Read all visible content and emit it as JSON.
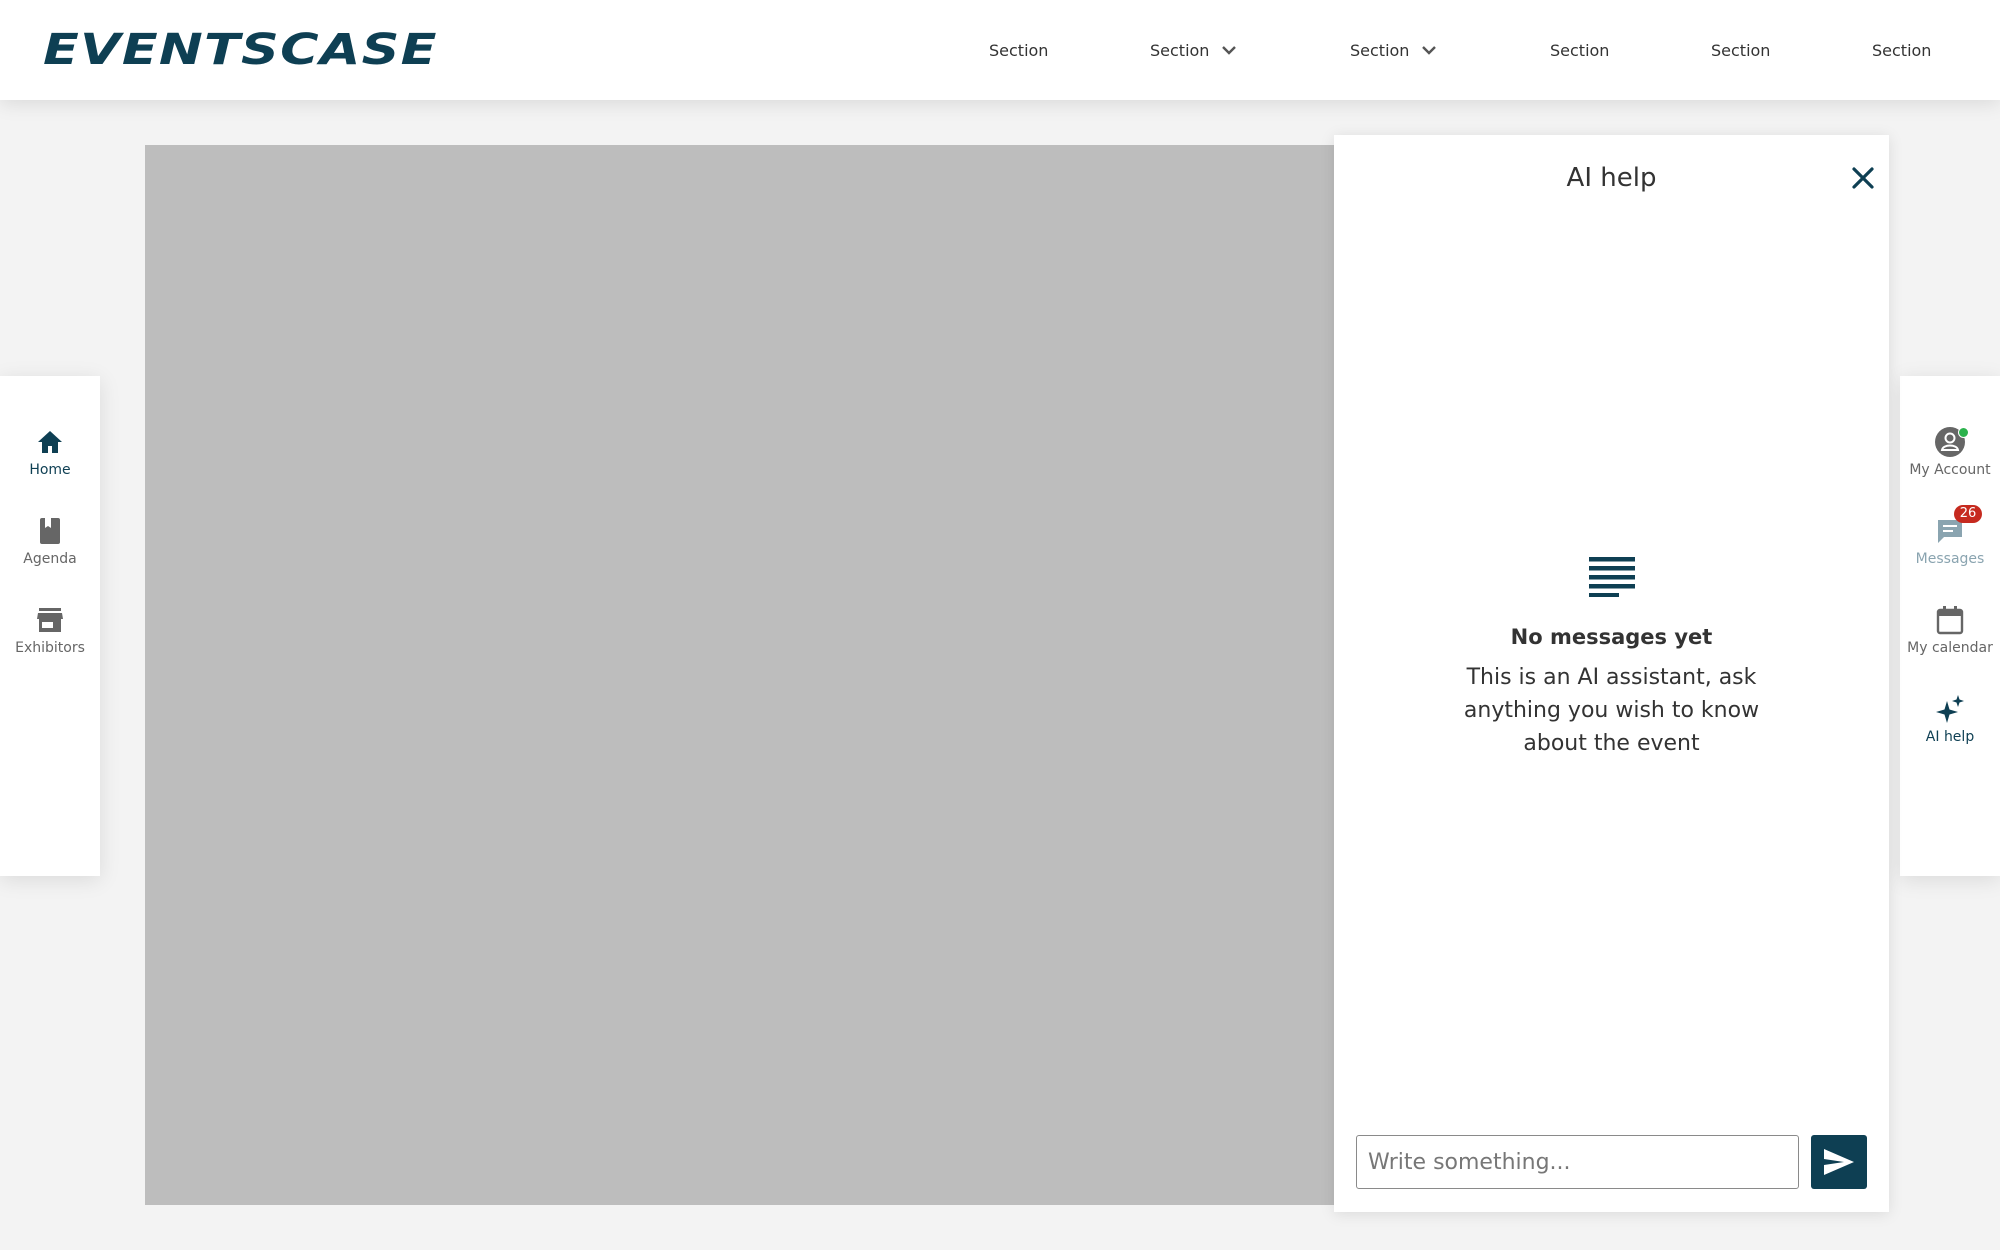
{
  "header": {
    "logo_text": "EVENTSCASE",
    "nav": [
      {
        "label": "Section",
        "has_dropdown": false
      },
      {
        "label": "Section",
        "has_dropdown": true
      },
      {
        "label": "Section",
        "has_dropdown": true
      },
      {
        "label": "Section",
        "has_dropdown": false
      },
      {
        "label": "Section",
        "has_dropdown": false
      },
      {
        "label": "Section",
        "has_dropdown": false
      }
    ]
  },
  "left_sidebar": {
    "items": [
      {
        "label": "Home",
        "icon": "home-icon",
        "active": true
      },
      {
        "label": "Agenda",
        "icon": "book-icon",
        "active": false
      },
      {
        "label": "Exhibitors",
        "icon": "store-icon",
        "active": false
      }
    ]
  },
  "right_sidebar": {
    "items": [
      {
        "label": "My Account",
        "icon": "account-icon",
        "status": "online"
      },
      {
        "label": "Messages",
        "icon": "chat-icon",
        "badge": "26"
      },
      {
        "label": "My calendar",
        "icon": "calendar-icon"
      },
      {
        "label": "AI help",
        "icon": "sparkle-icon",
        "active": true
      }
    ]
  },
  "ai_panel": {
    "title": "AI help",
    "empty_title": "No messages yet",
    "empty_text": "This is an AI assistant, ask anything you wish to know about the event",
    "input_placeholder": "Write something...",
    "input_value": ""
  },
  "colors": {
    "brand": "#0e3f53",
    "badge": "#c62a1f",
    "online": "#2bb24c",
    "hero_placeholder": "#bdbdbd"
  }
}
